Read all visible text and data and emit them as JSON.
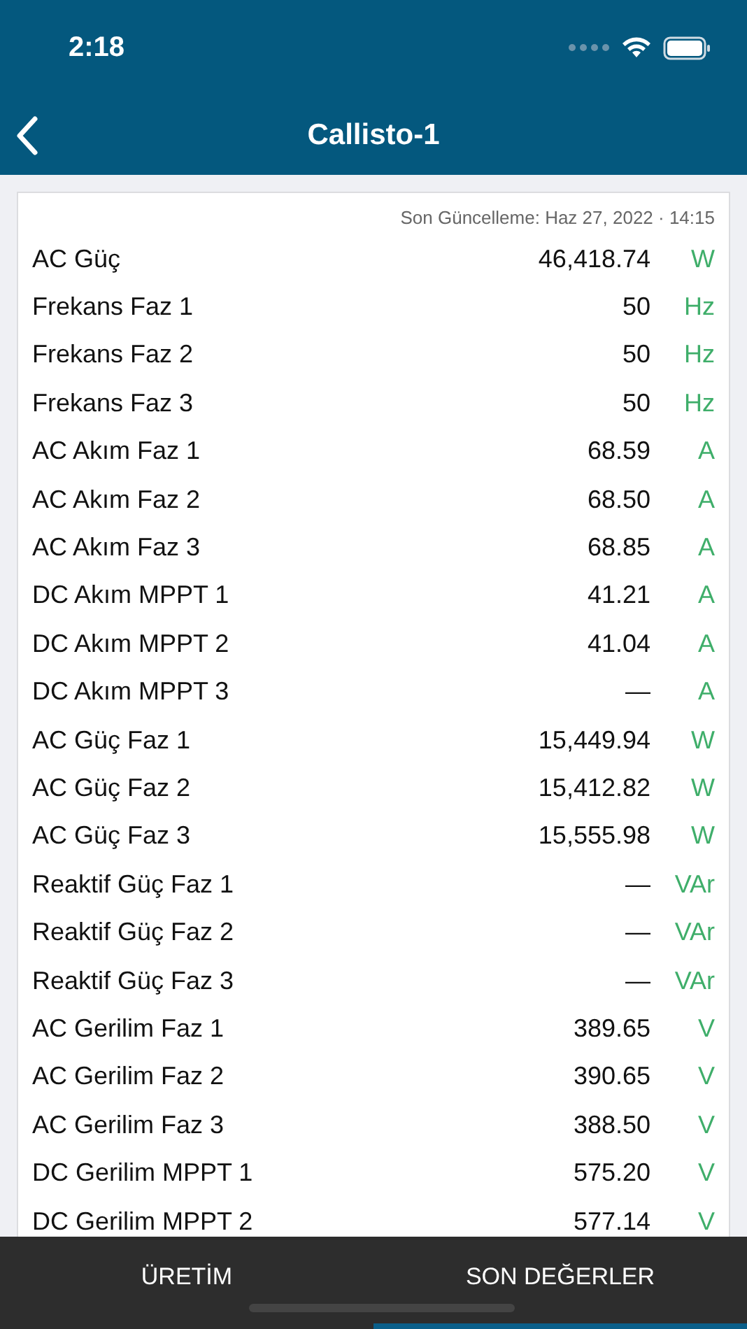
{
  "status_bar": {
    "time": "2:18"
  },
  "nav": {
    "title": "Callisto-1"
  },
  "updated": "Son Güncelleme: Haz 27, 2022 · 14:15",
  "rows": [
    {
      "label": "AC Güç",
      "value": "46,418.74",
      "unit": "W"
    },
    {
      "label": "Frekans Faz 1",
      "value": "50",
      "unit": "Hz"
    },
    {
      "label": "Frekans Faz 2",
      "value": "50",
      "unit": "Hz"
    },
    {
      "label": "Frekans Faz 3",
      "value": "50",
      "unit": "Hz"
    },
    {
      "label": "AC Akım Faz 1",
      "value": "68.59",
      "unit": "A"
    },
    {
      "label": "AC Akım Faz 2",
      "value": "68.50",
      "unit": "A"
    },
    {
      "label": "AC Akım Faz 3",
      "value": "68.85",
      "unit": "A"
    },
    {
      "label": "DC Akım MPPT 1",
      "value": "41.21",
      "unit": "A"
    },
    {
      "label": "DC Akım MPPT 2",
      "value": "41.04",
      "unit": "A"
    },
    {
      "label": "DC Akım MPPT 3",
      "value": "—",
      "unit": "A"
    },
    {
      "label": "AC Güç Faz 1",
      "value": "15,449.94",
      "unit": "W"
    },
    {
      "label": "AC Güç Faz 2",
      "value": "15,412.82",
      "unit": "W"
    },
    {
      "label": "AC Güç Faz 3",
      "value": "15,555.98",
      "unit": "W"
    },
    {
      "label": "Reaktif Güç Faz 1",
      "value": "—",
      "unit": "VAr"
    },
    {
      "label": "Reaktif Güç Faz 2",
      "value": "—",
      "unit": "VAr"
    },
    {
      "label": "Reaktif Güç Faz 3",
      "value": "—",
      "unit": "VAr"
    },
    {
      "label": "AC Gerilim Faz 1",
      "value": "389.65",
      "unit": "V"
    },
    {
      "label": "AC Gerilim Faz 2",
      "value": "390.65",
      "unit": "V"
    },
    {
      "label": "AC Gerilim Faz 3",
      "value": "388.50",
      "unit": "V"
    },
    {
      "label": "DC Gerilim MPPT 1",
      "value": "575.20",
      "unit": "V"
    },
    {
      "label": "DC Gerilim MPPT 2",
      "value": "577.14",
      "unit": "V"
    }
  ],
  "tabs": [
    {
      "label": "ÜRETİM",
      "selected": false
    },
    {
      "label": "SON DEĞERLER",
      "selected": true
    }
  ]
}
